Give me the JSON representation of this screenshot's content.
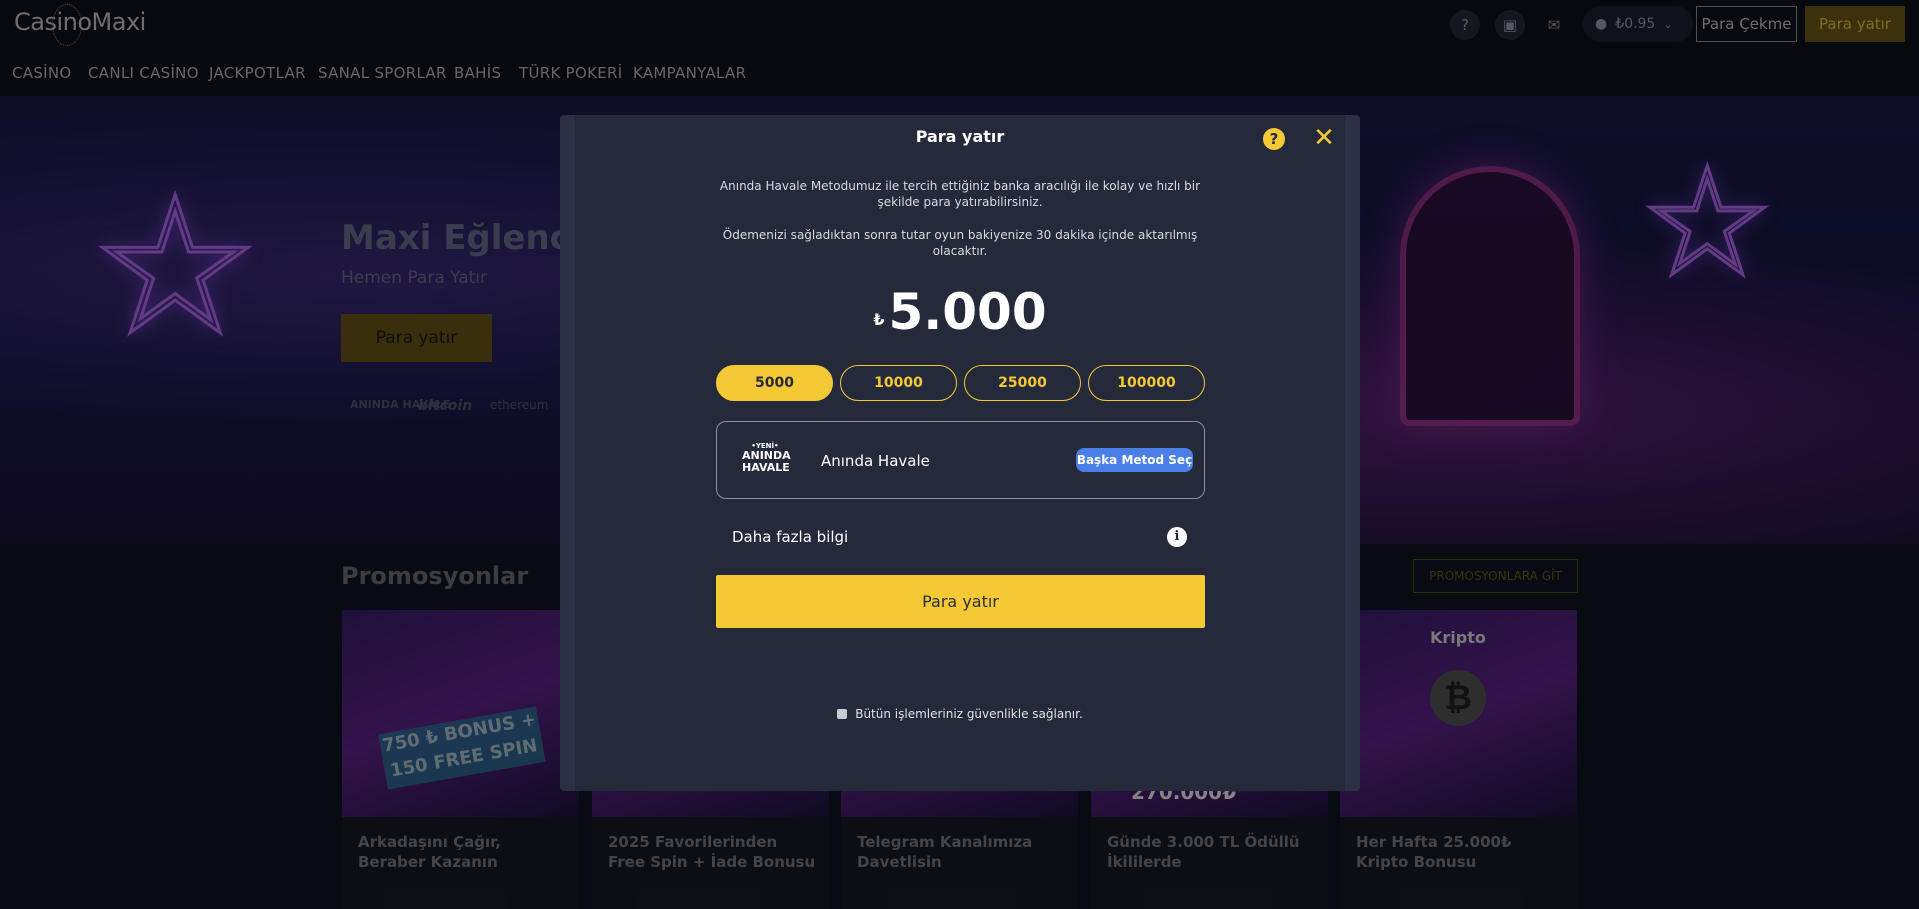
{
  "header": {
    "logo_text": "CasinoMaxi",
    "balance": "₺0.95",
    "withdraw_label": "Para Çekme",
    "deposit_label": "Para yatır",
    "icons": [
      "help-icon",
      "gift-icon",
      "mail-icon",
      "user-icon",
      "chevron-down-icon"
    ]
  },
  "nav": {
    "items": [
      "CASİNO",
      "CANLI CASİNO",
      "JACKPOTLAR",
      "SANAL SPORLAR",
      "BAHİS",
      "TÜRK POKERİ",
      "KAMPANYALAR"
    ]
  },
  "hero": {
    "title": "Maxi Eğlencey",
    "subtitle": "Hemen Para Yatır",
    "button": "Para yatır",
    "payment_logos": [
      "ANINDA HAVALE",
      "bitcoin",
      "ethereum"
    ]
  },
  "promotions": {
    "title": "Promosyonlar",
    "link": "PROMOSYONLARA GİT",
    "cards": [
      {
        "title": "Arkadaşını Çağır, Beraber Kazanın",
        "badge": "750 ₺ BONUS + 150 FREE SPIN"
      },
      {
        "title": "2025 Favorilerinden Free Spin + İade Bonusu"
      },
      {
        "title": "Telegram Kanalımıza Davetlisin"
      },
      {
        "title": "Günde 3.000 TL Ödüllü İkililerde",
        "badge": "270.000₺"
      },
      {
        "title": "Her Hafta 25.000₺ Kripto Bonusu",
        "badge": "Kripto"
      }
    ]
  },
  "modal": {
    "title": "Para yatır",
    "description_1": "Anında Havale Metodumuz ile tercih ettiğiniz banka aracılığı ile kolay ve hızlı bir şekilde para yatırabilirsiniz.",
    "description_2": "Ödemenizi sağladıktan sonra tutar oyun bakiyenize 30 dakika içinde aktarılmış olacaktır.",
    "currency_symbol": "₺",
    "amount": "5.000",
    "quick_amounts": [
      "5000",
      "10000",
      "25000",
      "100000"
    ],
    "selected_amount": "5000",
    "method_logo_small": "•YENİ•",
    "method_logo_main": "ANINDA HAVALE",
    "method_name": "Anında Havale",
    "change_method": "Başka Metod Seç",
    "more_info": "Daha fazla bilgi",
    "submit": "Para yatır",
    "secure_note": "Bütün işlemleriniz güvenlikle sağlanır."
  },
  "colors": {
    "accent": "#f5c935",
    "modal_bg": "#242a3a",
    "method_button": "#4a7fe8",
    "page_bg": "#0f1420"
  }
}
